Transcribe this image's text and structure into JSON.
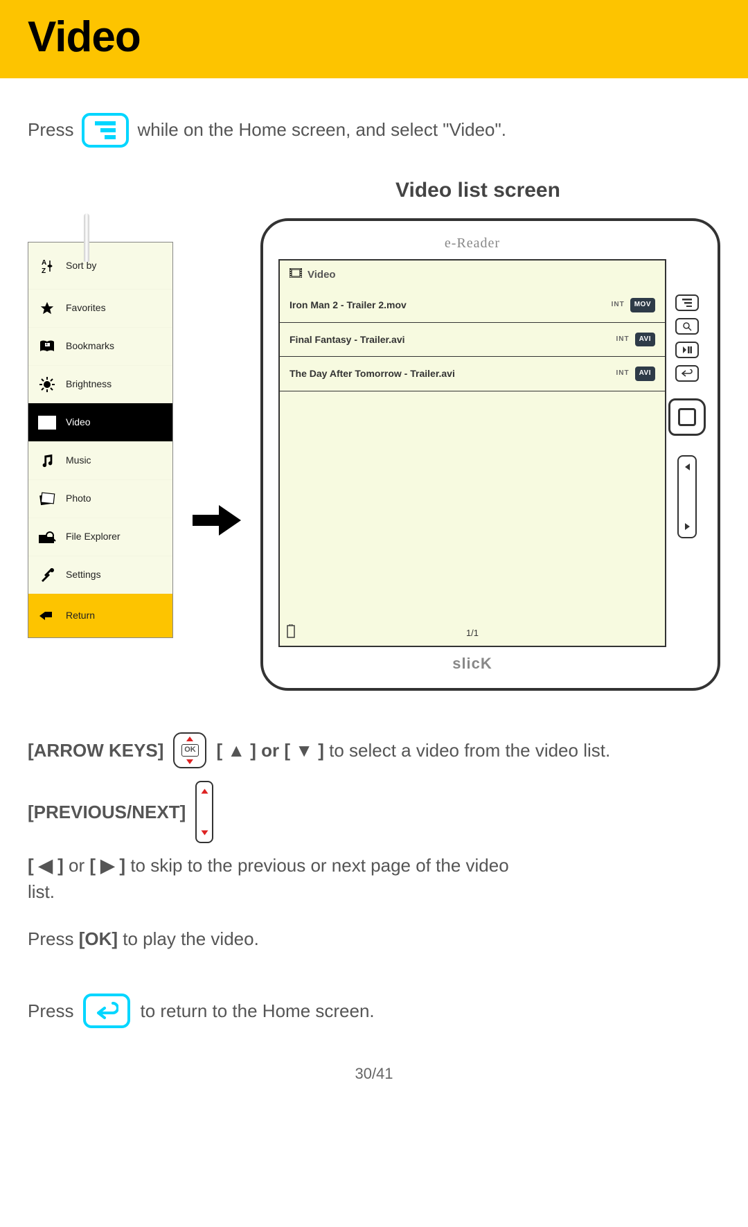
{
  "page": {
    "title": "Video",
    "page_number": "30/41"
  },
  "intro": {
    "press": "Press",
    "rest": "while on the Home screen, and select \"Video\"."
  },
  "subtitle": "Video list screen",
  "sidebar": {
    "items": [
      {
        "label": "Sort by",
        "icon": "sort-icon"
      },
      {
        "label": "Favorites",
        "icon": "star-icon"
      },
      {
        "label": "Bookmarks",
        "icon": "book-icon"
      },
      {
        "label": "Brightness",
        "icon": "sun-icon"
      },
      {
        "label": "Video",
        "icon": "video-icon",
        "selected": true
      },
      {
        "label": "Music",
        "icon": "music-icon"
      },
      {
        "label": "Photo",
        "icon": "photo-icon"
      },
      {
        "label": "File Explorer",
        "icon": "folder-icon"
      },
      {
        "label": "Settings",
        "icon": "tools-icon"
      },
      {
        "label": "Return",
        "icon": "return-icon",
        "return": true
      }
    ]
  },
  "device": {
    "brand_top": "e-Reader",
    "brand_bottom": "slicK",
    "screen_title": "Video",
    "page_indicator": "1/1",
    "videos": [
      {
        "title": "Iron Man 2 - Trailer 2.mov",
        "loc": "INT",
        "fmt": "MOV"
      },
      {
        "title": "Final Fantasy - Trailer.avi",
        "loc": "INT",
        "fmt": "AVI"
      },
      {
        "title": "The Day After Tomorrow - Trailer.avi",
        "loc": "INT",
        "fmt": "AVI"
      }
    ]
  },
  "instructions": {
    "arrow_keys_label": "[ARROW KEYS]",
    "arrow_keys_bold": "[ ▲ ] or [ ▼ ]",
    "arrow_keys_text": " to select a video from the video list.",
    "prev_next_label": "[PREVIOUS/NEXT]",
    "prev_next_bold_a": "[ ◀ ] ",
    "prev_next_mid": "or",
    "prev_next_bold_b": " [ ▶ ] ",
    "prev_next_text": "to skip to the previous or next page of the video list.",
    "press_ok_a": "Press ",
    "press_ok_bold": "[OK]",
    "press_ok_b": " to play the video.",
    "return_press": "Press",
    "return_text": "to return to the Home screen.",
    "ok_label": "OK"
  }
}
